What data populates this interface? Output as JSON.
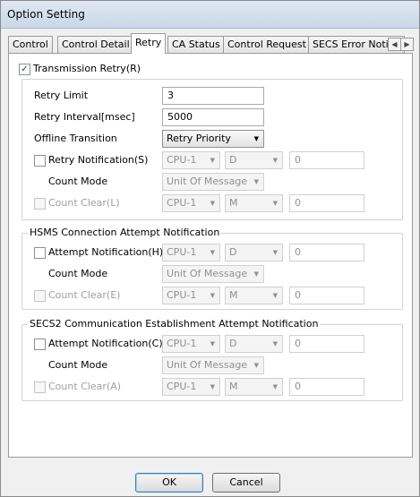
{
  "window": {
    "title": "Option Setting"
  },
  "tabs": [
    {
      "label": "Control"
    },
    {
      "label": "Control Detail"
    },
    {
      "label": "Retry"
    },
    {
      "label": "CA Status"
    },
    {
      "label": "Control Request"
    },
    {
      "label": "SECS Error Notific"
    }
  ],
  "active_tab": "Retry",
  "transmission_retry": {
    "label": "Transmission Retry(R)",
    "checked": true
  },
  "retry": {
    "limit_label": "Retry Limit",
    "limit_value": "3",
    "interval_label": "Retry Interval[msec]",
    "interval_value": "5000",
    "offline_label": "Offline Transition",
    "offline_value": "Retry Priority",
    "notification_label": "Retry Notification(S)",
    "notification_cpu": "CPU-1",
    "notification_dev": "D",
    "notification_num": "0",
    "count_mode_label": "Count Mode",
    "count_mode_value": "Unit Of Message",
    "count_clear_label": "Count Clear(L)",
    "count_clear_cpu": "CPU-1",
    "count_clear_dev": "M",
    "count_clear_num": "0"
  },
  "hsms": {
    "title": "HSMS Connection Attempt Notification",
    "notification_label": "Attempt Notification(H)",
    "notification_cpu": "CPU-1",
    "notification_dev": "D",
    "notification_num": "0",
    "count_mode_label": "Count Mode",
    "count_mode_value": "Unit Of Message",
    "count_clear_label": "Count Clear(E)",
    "count_clear_cpu": "CPU-1",
    "count_clear_dev": "M",
    "count_clear_num": "0"
  },
  "secs2": {
    "title": "SECS2 Communication Establishment Attempt Notification",
    "notification_label": "Attempt Notification(C)",
    "notification_cpu": "CPU-1",
    "notification_dev": "D",
    "notification_num": "0",
    "count_mode_label": "Count Mode",
    "count_mode_value": "Unit Of Message",
    "count_clear_label": "Count Clear(A)",
    "count_clear_cpu": "CPU-1",
    "count_clear_dev": "M",
    "count_clear_num": "0"
  },
  "buttons": {
    "ok": "OK",
    "cancel": "Cancel"
  },
  "icons": {
    "check": "✓",
    "dropdown": "▼",
    "scroll_left": "◀",
    "scroll_right": "▶"
  }
}
